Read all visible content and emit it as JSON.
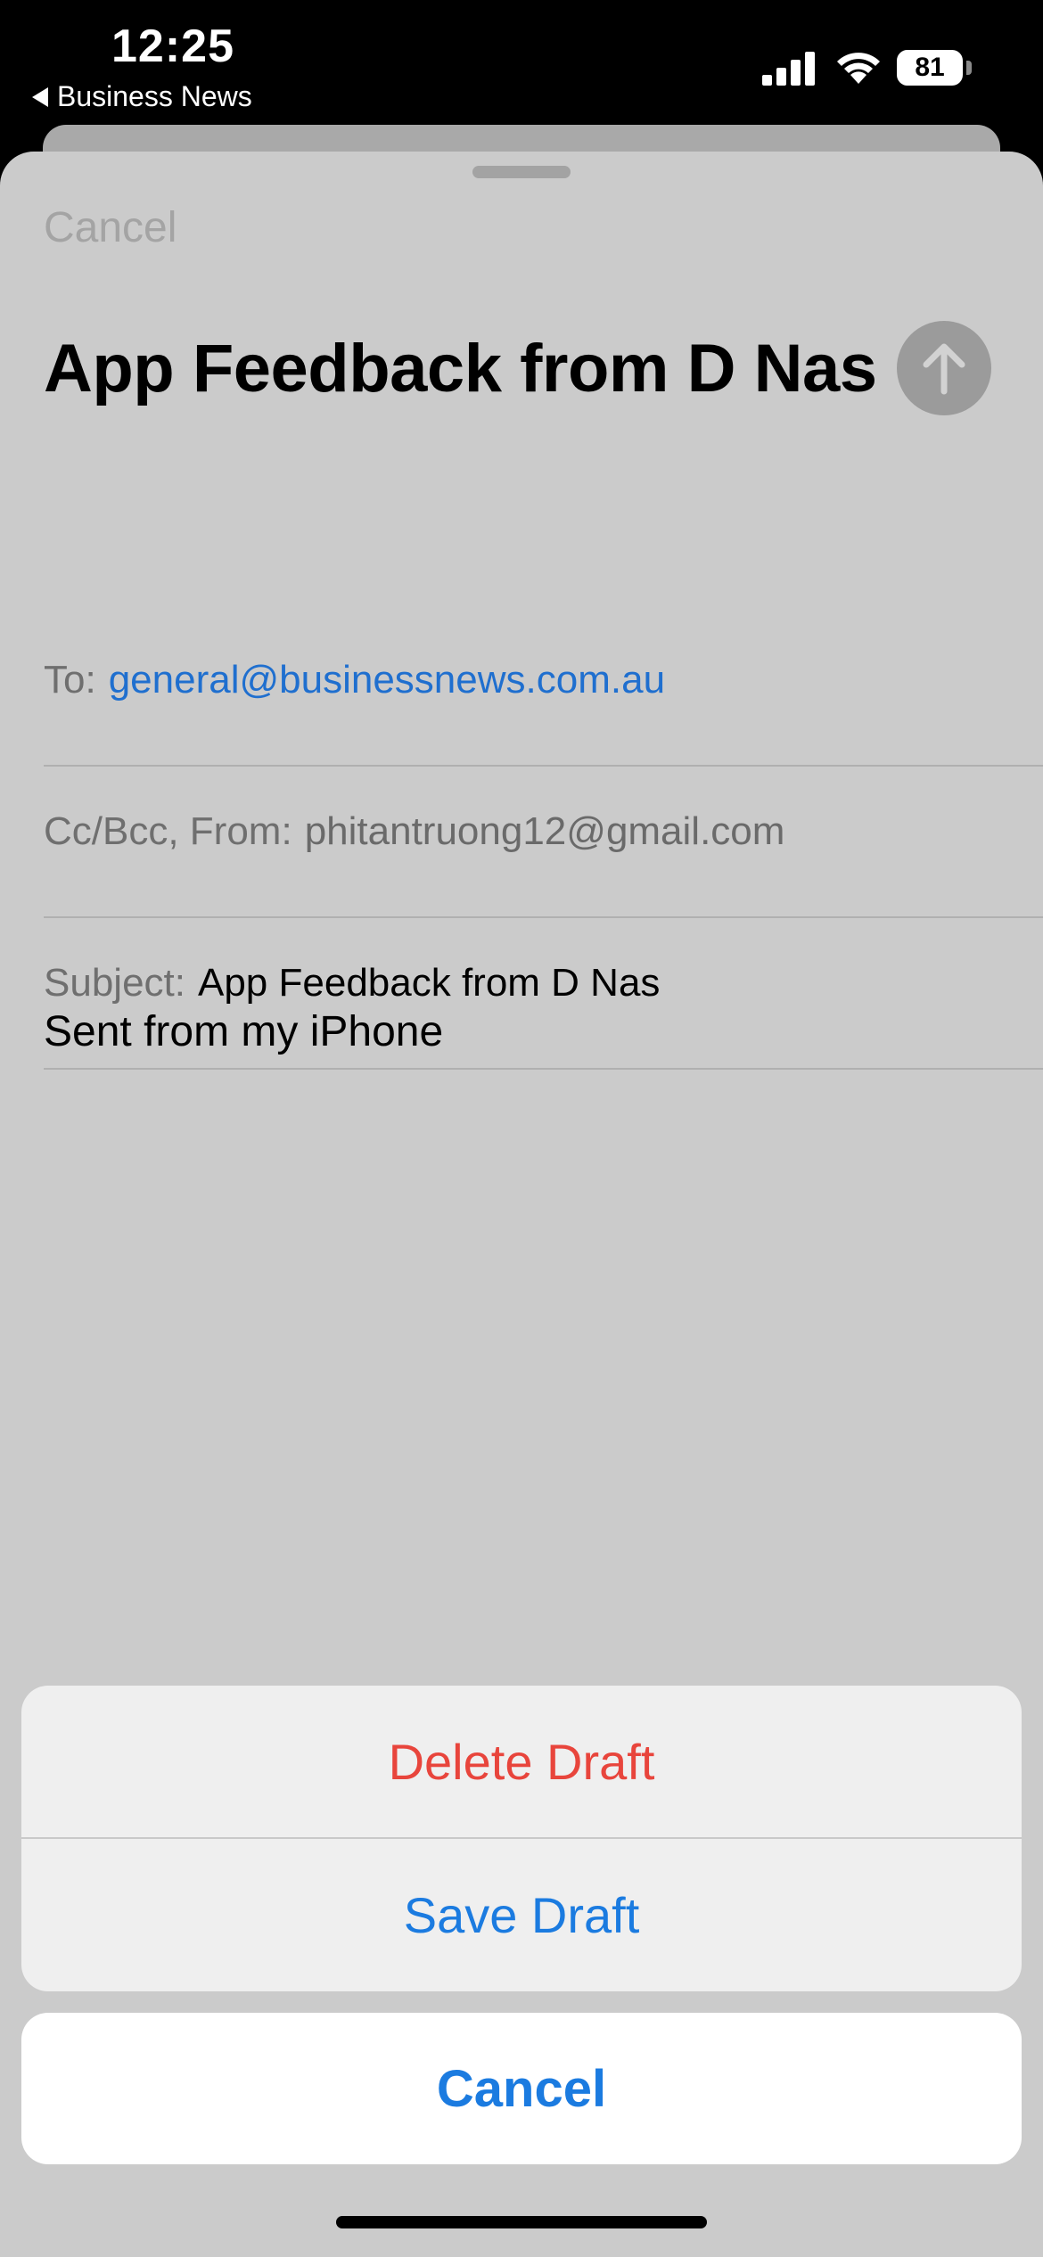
{
  "status_bar": {
    "time": "12:25",
    "back_app": "Business News",
    "battery": "81"
  },
  "compose": {
    "cancel_label": "Cancel",
    "title": "App Feedback from D Nas",
    "to_label": "To:",
    "to_value": "general@businessnews.com.au",
    "ccbcc_label": "Cc/Bcc, From:",
    "from_value": "phitantruong12@gmail.com",
    "subject_label": "Subject:",
    "subject_value": "App Feedback from D Nas",
    "body": "Sent from my iPhone"
  },
  "action_sheet": {
    "delete_label": "Delete Draft",
    "save_label": "Save Draft",
    "cancel_label": "Cancel"
  },
  "colors": {
    "destructive": "#e8453c",
    "accent": "#1b7be0",
    "sheet_bg": "#cbcbcb"
  },
  "icons": [
    "signal-icon",
    "wifi-icon",
    "battery-icon",
    "send-arrow-icon",
    "back-triangle-icon"
  ]
}
